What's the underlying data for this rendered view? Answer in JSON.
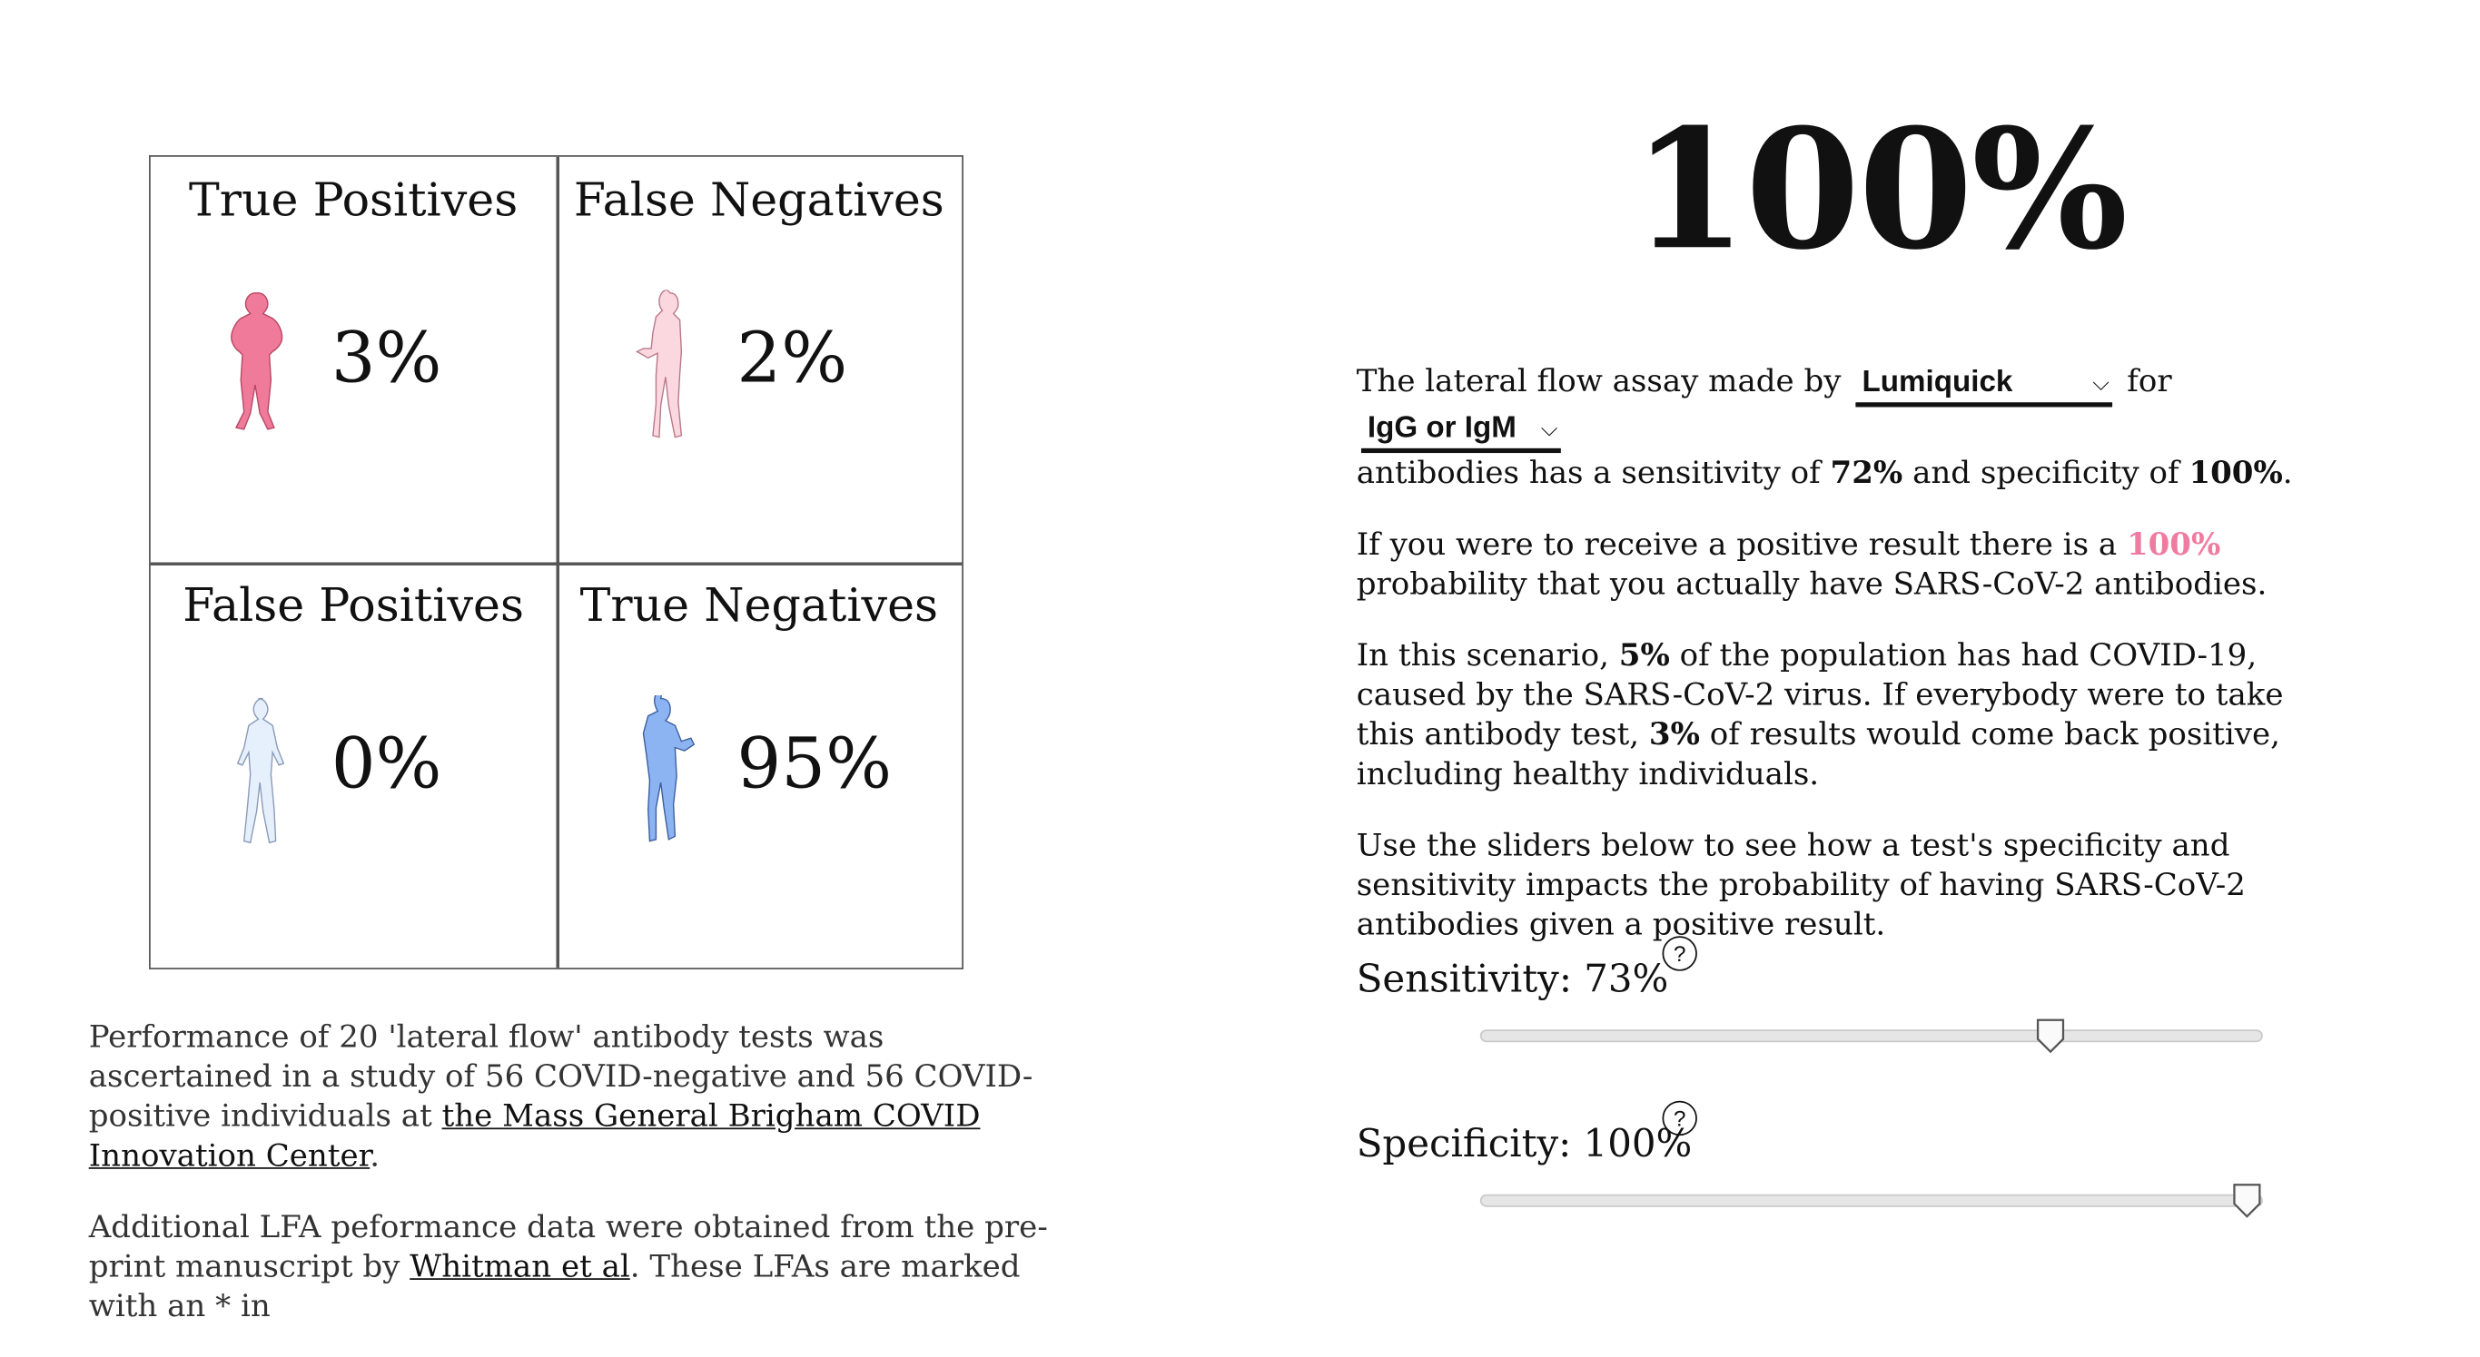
{
  "grid": {
    "cells": [
      {
        "title": "True Positives",
        "pct": "3%",
        "color": "#f07a99"
      },
      {
        "title": "False Negatives",
        "pct": "2%",
        "color": "#fbd7df"
      },
      {
        "title": "False Positives",
        "pct": "0%",
        "color": "#e6effc"
      },
      {
        "title": "True Negatives",
        "pct": "95%",
        "color": "#8cb4f2"
      }
    ]
  },
  "left": {
    "p1_before": "Performance of 20 'lateral flow' antibody tests was ascertained in a study of 56 COVID-negative and 56 COVID-positive individuals at ",
    "p1_link": "the Mass General Brigham COVID Innovation Center",
    "p1_after": ".",
    "p2_before": "Additional LFA peformance data were obtained from the pre-print manuscript by ",
    "p2_link": "Whitman et al",
    "p2_after": ". These LFAs are marked with an * in"
  },
  "probability": "100%",
  "right": {
    "intro_before": "The lateral flow assay made by",
    "maker_select": "Lumiquick",
    "intro_for": "for",
    "antibody_select": "IgG or IgM",
    "intro_after1": "antibodies has a sensitivity of ",
    "sensitivity": "72%",
    "intro_and": " and specificity of ",
    "specificity": "100%",
    "intro_end": ".",
    "p2_before": "If you were to receive a positive result there is a ",
    "p2_prob": "100%",
    "p2_after": " probability that you actually have SARS-CoV-2 antibodies.",
    "p3_a": "In this scenario, ",
    "p3_prev": "5%",
    "p3_b": " of the population has had COVID-19, caused by the SARS-CoV-2 virus. If everybody were to take this antibody test, ",
    "p3_pos": "3%",
    "p3_c": " of results would come back positive, including healthy individuals.",
    "p4": "Use the sliders below to see how a test's specificity and sensitivity impacts the probability of having SARS-CoV-2 antibodies given a positive result."
  },
  "sliders": {
    "sensitivity_label": "Sensitivity: 73%",
    "sensitivity_value": 0.73,
    "specificity_label": "Specificity: 100%",
    "specificity_value": 1.0,
    "help_glyph": "?"
  }
}
